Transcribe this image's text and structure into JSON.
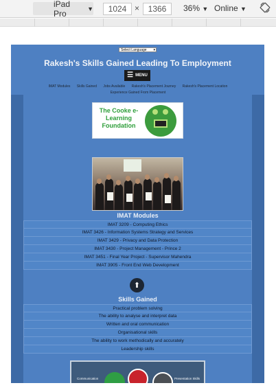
{
  "devtools": {
    "device": "iPad Pro",
    "width": "1024",
    "height": "1366",
    "zoom": "36%",
    "network": "Online",
    "rotate_icon": "rotate-icon"
  },
  "site": {
    "language_selector": "Select Language",
    "title": "Rakesh's Skills Gained Leading To Employment",
    "menu_label": "MENU",
    "nav": [
      "IMAT Modules",
      "Skills Gained",
      "Jobs Available",
      "Rakesh's Placement Journey",
      "Rakesh's Placement Location",
      "Experience Gained From Placement"
    ],
    "logo_text": "The Cooke e-Learning Foundation",
    "modules_title": "IMAT Modules",
    "modules": [
      "IMAT 3209 - Computing Ethics",
      "IMAT 3426 - Information Systems Strategy and Services",
      "IMAT 3429 - Privacy and Data Protection",
      "IMAT 3430 - Project Management - Prince 2",
      "IMAT 3451 - Final Year Project - Supervisor Mahendra",
      "IMAT 3905 - Front End Web Development"
    ],
    "skills_title": "Skills Gained",
    "skills": [
      "Practical problem solving",
      "The ability to analyse and interpret data",
      "Written and oral communication",
      "Organisational skills",
      "The ability to work methodically and accurately",
      "Leadership skills"
    ],
    "bottom_labels": [
      "Communication",
      "Presentation Skills"
    ]
  },
  "colors": {
    "page_blue": "#4e80c2",
    "side_blue": "#3d6aa6",
    "logo_green": "#2e9e3a"
  }
}
